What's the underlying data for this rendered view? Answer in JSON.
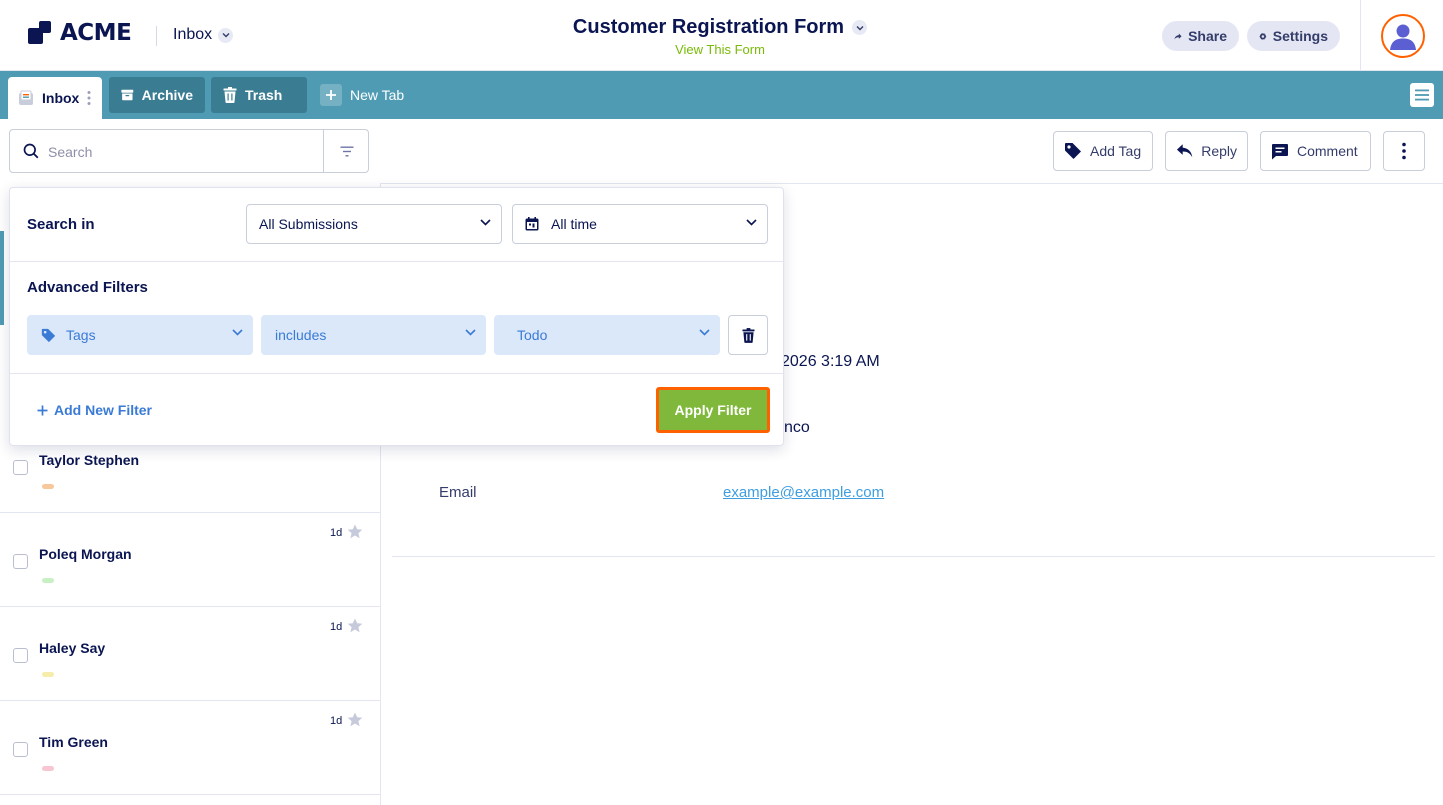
{
  "header": {
    "logo_text": "ACME",
    "inbox_label": "Inbox",
    "form_title": "Customer Registration Form",
    "form_subtitle": "View This Form",
    "share_label": "Share",
    "settings_label": "Settings"
  },
  "tabs": [
    {
      "label": "Inbox"
    },
    {
      "label": "Archive"
    },
    {
      "label": "Trash"
    },
    {
      "label": "New Tab"
    }
  ],
  "search": {
    "placeholder": "Search",
    "value": ""
  },
  "toolbar": {
    "add_tag_label": "Add Tag",
    "reply_label": "Reply",
    "comment_label": "Comment"
  },
  "filter_panel": {
    "search_in_label": "Search in",
    "scope_value": "All Submissions",
    "time_value": "All time",
    "advanced_label": "Advanced Filters",
    "field_value": "Tags",
    "operator_value": "includes",
    "tag_value": "Todo",
    "add_filter_label": "Add New Filter",
    "apply_label": "Apply Filter"
  },
  "submissions": [
    {
      "name": "Taylor Stephen",
      "age": "",
      "tag_color": "#f6c89a"
    },
    {
      "name": "Poleq Morgan",
      "age": "1d",
      "tag_color": "#c9f0c4"
    },
    {
      "name": "Haley Say",
      "age": "1d",
      "tag_color": "#f6ecab"
    },
    {
      "name": "Tim Green",
      "age": "1d",
      "tag_color": "#f7c6d2"
    }
  ],
  "detail": {
    "date_partial": "2026 3:19 AM",
    "name_partial": "nco",
    "email_label": "Email",
    "email_value": "example@example.com"
  },
  "colors": {
    "accent_teal": "#4f9bb3",
    "apply_green": "#7fb83a",
    "highlight_orange": "#ff6100",
    "link_blue": "#3e9ee0"
  }
}
